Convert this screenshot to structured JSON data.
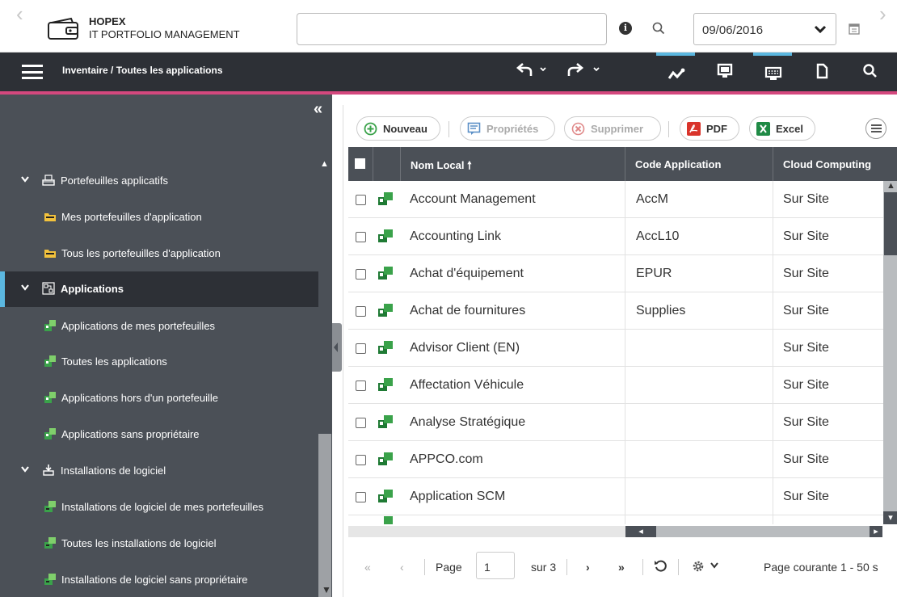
{
  "header": {
    "brand_name": "HOPEX",
    "brand_sub": "IT PORTFOLIO MANAGEMENT",
    "search_value": "",
    "date_value": "09/06/2016"
  },
  "toolbar": {
    "breadcrumb": "Inventaire / Toutes les applications",
    "accent_color": "#d4487e",
    "active_color": "#5bb7e0"
  },
  "sidebar": {
    "collapse_glyph": "«",
    "items": [
      {
        "label": "Portefeuilles applicatifs",
        "icon": "portfolio-icon"
      },
      {
        "label": "Mes portefeuilles d'application",
        "icon": "folder-portfolio-icon"
      },
      {
        "label": "Tous les portefeuilles d'application",
        "icon": "folder-portfolio-icon"
      },
      {
        "label": "Applications",
        "icon": "applications-icon"
      },
      {
        "label": "Applications de mes portefeuilles",
        "icon": "application-icon"
      },
      {
        "label": "Toutes les applications",
        "icon": "application-icon"
      },
      {
        "label": "Applications hors d'un portefeuille",
        "icon": "application-icon"
      },
      {
        "label": "Applications sans propriétaire",
        "icon": "application-icon"
      },
      {
        "label": "Installations de logiciel",
        "icon": "software-installation-icon"
      },
      {
        "label": "Installations de logiciel de mes portefeuilles",
        "icon": "software-install-icon"
      },
      {
        "label": "Toutes les installations de logiciel",
        "icon": "software-install-icon"
      },
      {
        "label": "Installations de logiciel sans propriétaire",
        "icon": "software-install-icon"
      }
    ]
  },
  "actions": {
    "new": "Nouveau",
    "properties": "Propriétés",
    "delete": "Supprimer",
    "pdf": "PDF",
    "excel": "Excel"
  },
  "grid": {
    "columns": [
      "Nom Local",
      "Code Application",
      "Cloud Computing"
    ],
    "rows": [
      {
        "name": "Account Management",
        "code": "AccM",
        "cloud": "Sur Site"
      },
      {
        "name": "Accounting Link",
        "code": "AccL10",
        "cloud": "Sur Site"
      },
      {
        "name": "Achat d'équipement",
        "code": "EPUR",
        "cloud": "Sur Site"
      },
      {
        "name": "Achat de fournitures",
        "code": "Supplies",
        "cloud": "Sur Site"
      },
      {
        "name": "Advisor Client (EN)",
        "code": "",
        "cloud": "Sur Site"
      },
      {
        "name": "Affectation Véhicule",
        "code": "",
        "cloud": "Sur Site"
      },
      {
        "name": "Analyse Stratégique",
        "code": "",
        "cloud": "Sur Site"
      },
      {
        "name": "APPCO.com",
        "code": "",
        "cloud": "Sur Site"
      },
      {
        "name": "Application SCM",
        "code": "",
        "cloud": "Sur Site"
      }
    ]
  },
  "pager": {
    "page_label": "Page",
    "page_value": "1",
    "of_label": "sur 3",
    "current_label": "Page courante 1 - 50 s"
  }
}
